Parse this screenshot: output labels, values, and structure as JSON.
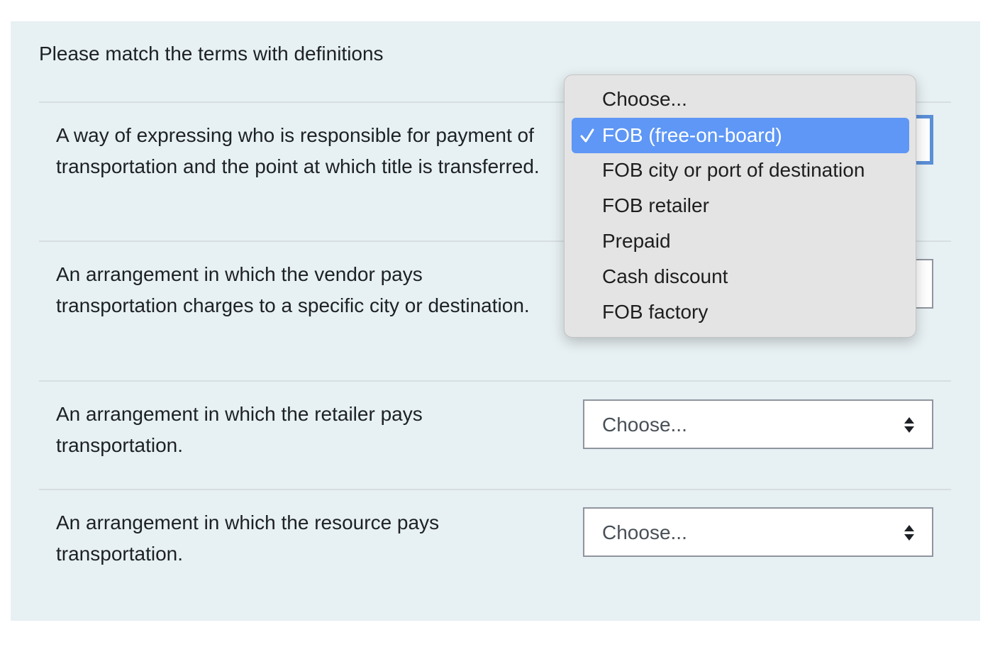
{
  "question": {
    "prompt": "Please match the terms with definitions",
    "stems": [
      "A way of expressing who is responsible for payment of transportation and the point at which title is transferred.",
      "An arrangement in which the vendor pays transportation charges to a specific city or destination.",
      "An arrangement in which the retailer pays transportation.",
      "An arrangement in which the resource pays transportation."
    ],
    "answers": [
      "",
      "",
      "Choose...",
      "Choose..."
    ]
  },
  "dropdown": {
    "selected_value": "FOB (free-on-board)",
    "options": [
      "Choose...",
      "FOB (free-on-board)",
      "FOB city or port of destination",
      "FOB retailer",
      "Prepaid",
      "Cash discount",
      "FOB factory"
    ]
  },
  "icons": {
    "select": "up-down-arrows-icon",
    "selected_option": "checkmark-icon"
  },
  "colors": {
    "panel_background": "#e7f0f3",
    "focus_ring": "#5b8fd6",
    "menu_highlight": "#5e97f5",
    "menu_background": "#e4e4e4"
  }
}
